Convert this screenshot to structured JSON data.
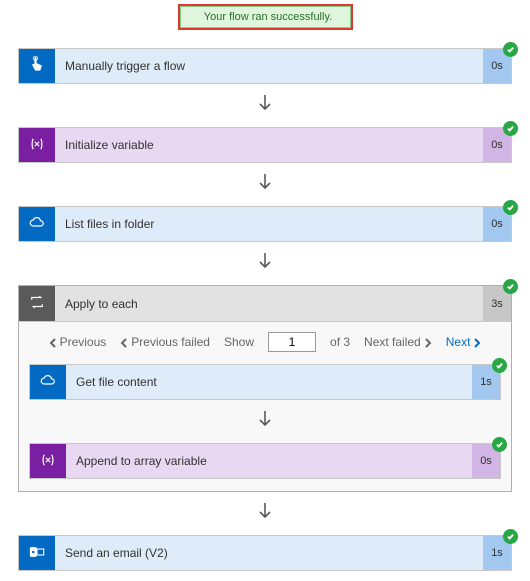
{
  "banner": {
    "text": "Your flow ran successfully."
  },
  "steps": {
    "trigger": {
      "label": "Manually trigger a flow",
      "time": "0s"
    },
    "initvar": {
      "label": "Initialize variable",
      "time": "0s"
    },
    "listfiles": {
      "label": "List files in folder",
      "time": "0s"
    },
    "loop": {
      "label": "Apply to each",
      "time": "3s"
    },
    "getfile": {
      "label": "Get file content",
      "time": "1s"
    },
    "append": {
      "label": "Append to array variable",
      "time": "0s"
    },
    "email": {
      "label": "Send an email (V2)",
      "time": "1s"
    }
  },
  "pager": {
    "prev": "Previous",
    "prevFailed": "Previous failed",
    "show": "Show",
    "value": "1",
    "ofText": "of 3",
    "nextFailed": "Next failed",
    "next": "Next"
  }
}
